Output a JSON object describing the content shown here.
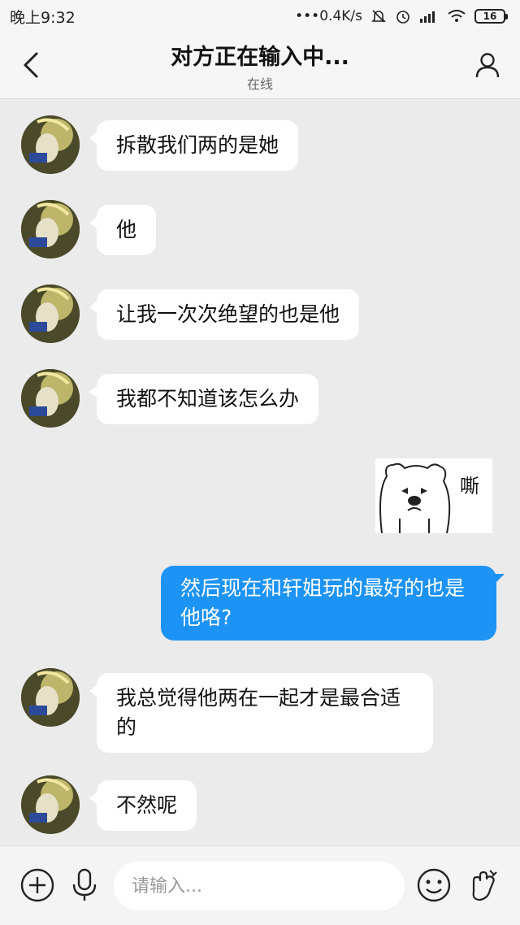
{
  "status_bar": {
    "time": "晚上9:32",
    "network_speed": "0.4K/s",
    "battery": "16"
  },
  "header": {
    "title": "对方正在输入中...",
    "subtitle": "在线"
  },
  "messages": [
    {
      "sender": "other",
      "text": "拆散我们两的是她"
    },
    {
      "sender": "other",
      "text": "他"
    },
    {
      "sender": "other",
      "text": "让我一次次绝望的也是他"
    },
    {
      "sender": "other",
      "text": "我都不知道该怎么办"
    },
    {
      "sender": "me",
      "type": "sticker",
      "text": "嘶"
    },
    {
      "sender": "me",
      "text": "然后现在和轩姐玩的最好的也是他咯?"
    },
    {
      "sender": "other",
      "text": "我总觉得他两在一起才是最合适的"
    },
    {
      "sender": "other",
      "text": "不然呢"
    }
  ],
  "input": {
    "placeholder": "请输入..."
  },
  "colors": {
    "outgoing_bubble": "#1d93f5",
    "incoming_bubble": "#ffffff",
    "chat_background": "#ebebeb"
  },
  "icons": {
    "back": "chevron-left-icon",
    "profile": "person-icon",
    "add": "plus-circle-icon",
    "voice": "microphone-icon",
    "emoji": "smile-icon",
    "gesture": "finger-heart-icon"
  }
}
